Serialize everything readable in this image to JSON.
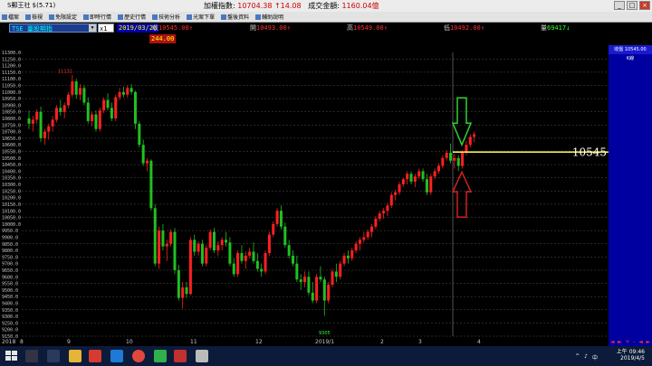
{
  "window": {
    "title": "S郵王社 $(5.71)",
    "min_label": "_",
    "max_label": "□",
    "close_label": "×"
  },
  "index_info": {
    "label": "加權指數:",
    "value": "10704.38",
    "change": "↑14.08",
    "volume_label": "成交金額:",
    "volume": "1160.04億"
  },
  "menu": [
    {
      "label": "檔案"
    },
    {
      "label": "檢視"
    },
    {
      "label": "免限設定"
    },
    {
      "label": "即時行情"
    },
    {
      "label": "歷史行情"
    },
    {
      "label": "技術分析"
    },
    {
      "label": "光案下單"
    },
    {
      "label": "盤後資料"
    },
    {
      "label": "輔助說明"
    }
  ],
  "toolbar": {
    "stock": "TSE 臺股期指",
    "stock_dropdown": "▼",
    "multiplier": "x1",
    "date": "2019/03/20",
    "quotes": [
      {
        "label": "收",
        "value": "10545.00↑",
        "color": "red"
      },
      {
        "label": "開",
        "value": "10493.00↑",
        "color": "red"
      },
      {
        "label": "高",
        "value": "10549.00↑",
        "color": "red"
      },
      {
        "label": "低",
        "value": "10492.00↑",
        "color": "red"
      },
      {
        "label": "量",
        "value": "69417↓",
        "color": "green"
      }
    ],
    "sub_price": "244.00"
  },
  "chart_data": {
    "type": "candlestick",
    "y_ticks": [
      "11300.0",
      "11250.0",
      "11200.0",
      "11150.0",
      "11100.0",
      "11050.0",
      "11000.0",
      "10950.0",
      "10900.0",
      "10850.0",
      "10800.0",
      "10750.0",
      "10700.0",
      "10650.0",
      "10600.0",
      "10550.0",
      "10500.0",
      "10450.0",
      "10400.0",
      "10350.0",
      "10300.0",
      "10250.0",
      "10200.0",
      "10150.0",
      "10100.0",
      "10050.0",
      "10000.0",
      "9950.0",
      "9900.0",
      "9850.0",
      "9800.0",
      "9750.0",
      "9700.0",
      "9650.0",
      "9600.0",
      "9550.0",
      "9500.0",
      "9450.0",
      "9400.0",
      "9350.0",
      "9300.0",
      "9250.0",
      "9200.0",
      "9150.0"
    ],
    "ylim": [
      9150,
      11300
    ],
    "x_ticks": [
      "2018",
      "8",
      "9",
      "10",
      "11",
      "12",
      "2019/1",
      "2",
      "3",
      "4"
    ],
    "high_annotation": "11131",
    "low_annotation": "9305",
    "current_price_line": 10545,
    "current_price_label": "10545",
    "cursor_label": "10545.00",
    "cursor_title": "收盤",
    "cursor_panel_label": "K線",
    "grid": true,
    "candles": [
      {
        "o": 10800,
        "h": 10860,
        "l": 10720,
        "c": 10760
      },
      {
        "o": 10760,
        "h": 10820,
        "l": 10700,
        "c": 10790
      },
      {
        "o": 10790,
        "h": 10870,
        "l": 10760,
        "c": 10850
      },
      {
        "o": 10850,
        "h": 10890,
        "l": 10620,
        "c": 10650
      },
      {
        "o": 10650,
        "h": 10720,
        "l": 10600,
        "c": 10700
      },
      {
        "o": 10700,
        "h": 10760,
        "l": 10640,
        "c": 10740
      },
      {
        "o": 10740,
        "h": 10820,
        "l": 10700,
        "c": 10790
      },
      {
        "o": 10790,
        "h": 10900,
        "l": 10770,
        "c": 10880
      },
      {
        "o": 10880,
        "h": 10940,
        "l": 10820,
        "c": 10850
      },
      {
        "o": 10850,
        "h": 10920,
        "l": 10800,
        "c": 10900
      },
      {
        "o": 10900,
        "h": 11000,
        "l": 10880,
        "c": 10980
      },
      {
        "o": 10980,
        "h": 11131,
        "l": 10960,
        "c": 11080
      },
      {
        "o": 11080,
        "h": 11100,
        "l": 10950,
        "c": 10980
      },
      {
        "o": 10980,
        "h": 11060,
        "l": 10940,
        "c": 11030
      },
      {
        "o": 11030,
        "h": 11050,
        "l": 10900,
        "c": 10920
      },
      {
        "o": 10920,
        "h": 10960,
        "l": 10760,
        "c": 10780
      },
      {
        "o": 10780,
        "h": 10850,
        "l": 10740,
        "c": 10830
      },
      {
        "o": 10830,
        "h": 10860,
        "l": 10700,
        "c": 10720
      },
      {
        "o": 10720,
        "h": 10880,
        "l": 10700,
        "c": 10860
      },
      {
        "o": 10860,
        "h": 10960,
        "l": 10840,
        "c": 10940
      },
      {
        "o": 10940,
        "h": 10990,
        "l": 10860,
        "c": 10880
      },
      {
        "o": 10880,
        "h": 10920,
        "l": 10780,
        "c": 10800
      },
      {
        "o": 10800,
        "h": 10980,
        "l": 10780,
        "c": 10960
      },
      {
        "o": 10960,
        "h": 11030,
        "l": 10940,
        "c": 11000
      },
      {
        "o": 11000,
        "h": 11040,
        "l": 10960,
        "c": 10980
      },
      {
        "o": 10980,
        "h": 11050,
        "l": 10960,
        "c": 11030
      },
      {
        "o": 11030,
        "h": 11060,
        "l": 10980,
        "c": 11000
      },
      {
        "o": 11000,
        "h": 11010,
        "l": 10720,
        "c": 10760
      },
      {
        "o": 10760,
        "h": 10780,
        "l": 10580,
        "c": 10600
      },
      {
        "o": 10600,
        "h": 10640,
        "l": 10440,
        "c": 10460
      },
      {
        "o": 10460,
        "h": 10500,
        "l": 10400,
        "c": 10480
      },
      {
        "o": 10480,
        "h": 10490,
        "l": 10100,
        "c": 10120
      },
      {
        "o": 10120,
        "h": 10150,
        "l": 9680,
        "c": 9700
      },
      {
        "o": 9700,
        "h": 9980,
        "l": 9660,
        "c": 9950
      },
      {
        "o": 9950,
        "h": 10000,
        "l": 9800,
        "c": 9830
      },
      {
        "o": 9830,
        "h": 9880,
        "l": 9720,
        "c": 9850
      },
      {
        "o": 9850,
        "h": 9960,
        "l": 9830,
        "c": 9940
      },
      {
        "o": 9940,
        "h": 9970,
        "l": 9620,
        "c": 9650
      },
      {
        "o": 9650,
        "h": 9690,
        "l": 9420,
        "c": 9440
      },
      {
        "o": 9440,
        "h": 9560,
        "l": 9360,
        "c": 9520
      },
      {
        "o": 9520,
        "h": 9560,
        "l": 9440,
        "c": 9470
      },
      {
        "o": 9470,
        "h": 9900,
        "l": 9460,
        "c": 9880
      },
      {
        "o": 9880,
        "h": 9920,
        "l": 9760,
        "c": 9790
      },
      {
        "o": 9790,
        "h": 9870,
        "l": 9760,
        "c": 9850
      },
      {
        "o": 9850,
        "h": 9880,
        "l": 9680,
        "c": 9700
      },
      {
        "o": 9700,
        "h": 9840,
        "l": 9680,
        "c": 9820
      },
      {
        "o": 9820,
        "h": 9960,
        "l": 9800,
        "c": 9940
      },
      {
        "o": 9940,
        "h": 9970,
        "l": 9780,
        "c": 9800
      },
      {
        "o": 9800,
        "h": 9870,
        "l": 9760,
        "c": 9840
      },
      {
        "o": 9840,
        "h": 9900,
        "l": 9800,
        "c": 9880
      },
      {
        "o": 9880,
        "h": 9940,
        "l": 9830,
        "c": 9860
      },
      {
        "o": 9860,
        "h": 9900,
        "l": 9680,
        "c": 9700
      },
      {
        "o": 9700,
        "h": 9740,
        "l": 9600,
        "c": 9620
      },
      {
        "o": 9620,
        "h": 9800,
        "l": 9600,
        "c": 9780
      },
      {
        "o": 9780,
        "h": 9840,
        "l": 9700,
        "c": 9720
      },
      {
        "o": 9720,
        "h": 9790,
        "l": 9660,
        "c": 9760
      },
      {
        "o": 9760,
        "h": 9820,
        "l": 9740,
        "c": 9790
      },
      {
        "o": 9790,
        "h": 9860,
        "l": 9700,
        "c": 9720
      },
      {
        "o": 9720,
        "h": 9780,
        "l": 9640,
        "c": 9660
      },
      {
        "o": 9660,
        "h": 9700,
        "l": 9600,
        "c": 9640
      },
      {
        "o": 9640,
        "h": 9800,
        "l": 9620,
        "c": 9780
      },
      {
        "o": 9780,
        "h": 9940,
        "l": 9760,
        "c": 9920
      },
      {
        "o": 9920,
        "h": 10020,
        "l": 9900,
        "c": 10000
      },
      {
        "o": 10000,
        "h": 10120,
        "l": 9980,
        "c": 10100
      },
      {
        "o": 10100,
        "h": 10140,
        "l": 9960,
        "c": 9980
      },
      {
        "o": 9980,
        "h": 10010,
        "l": 9820,
        "c": 9840
      },
      {
        "o": 9840,
        "h": 9880,
        "l": 9740,
        "c": 9760
      },
      {
        "o": 9760,
        "h": 9800,
        "l": 9680,
        "c": 9700
      },
      {
        "o": 9700,
        "h": 9760,
        "l": 9560,
        "c": 9580
      },
      {
        "o": 9580,
        "h": 9620,
        "l": 9500,
        "c": 9560
      },
      {
        "o": 9560,
        "h": 9640,
        "l": 9520,
        "c": 9600
      },
      {
        "o": 9600,
        "h": 9640,
        "l": 9460,
        "c": 9480
      },
      {
        "o": 9480,
        "h": 9560,
        "l": 9400,
        "c": 9420
      },
      {
        "o": 9420,
        "h": 9620,
        "l": 9400,
        "c": 9600
      },
      {
        "o": 9600,
        "h": 9680,
        "l": 9560,
        "c": 9580
      },
      {
        "o": 9580,
        "h": 9600,
        "l": 9305,
        "c": 9420
      },
      {
        "o": 9420,
        "h": 9560,
        "l": 9400,
        "c": 9540
      },
      {
        "o": 9540,
        "h": 9660,
        "l": 9520,
        "c": 9640
      },
      {
        "o": 9640,
        "h": 9700,
        "l": 9560,
        "c": 9600
      },
      {
        "o": 9600,
        "h": 9720,
        "l": 9580,
        "c": 9700
      },
      {
        "o": 9700,
        "h": 9780,
        "l": 9680,
        "c": 9760
      },
      {
        "o": 9760,
        "h": 9800,
        "l": 9700,
        "c": 9740
      },
      {
        "o": 9740,
        "h": 9820,
        "l": 9720,
        "c": 9800
      },
      {
        "o": 9800,
        "h": 9870,
        "l": 9780,
        "c": 9850
      },
      {
        "o": 9850,
        "h": 9900,
        "l": 9800,
        "c": 9880
      },
      {
        "o": 9880,
        "h": 9940,
        "l": 9860,
        "c": 9900
      },
      {
        "o": 9900,
        "h": 9960,
        "l": 9880,
        "c": 9940
      },
      {
        "o": 9940,
        "h": 10000,
        "l": 9900,
        "c": 9980
      },
      {
        "o": 9980,
        "h": 10060,
        "l": 9960,
        "c": 10040
      },
      {
        "o": 10040,
        "h": 10100,
        "l": 10020,
        "c": 10080
      },
      {
        "o": 10080,
        "h": 10120,
        "l": 10040,
        "c": 10100
      },
      {
        "o": 10100,
        "h": 10160,
        "l": 10060,
        "c": 10140
      },
      {
        "o": 10140,
        "h": 10240,
        "l": 10120,
        "c": 10220
      },
      {
        "o": 10220,
        "h": 10260,
        "l": 10180,
        "c": 10240
      },
      {
        "o": 10240,
        "h": 10320,
        "l": 10220,
        "c": 10300
      },
      {
        "o": 10300,
        "h": 10350,
        "l": 10280,
        "c": 10340
      },
      {
        "o": 10340,
        "h": 10400,
        "l": 10300,
        "c": 10380
      },
      {
        "o": 10380,
        "h": 10400,
        "l": 10300,
        "c": 10320
      },
      {
        "o": 10320,
        "h": 10380,
        "l": 10280,
        "c": 10360
      },
      {
        "o": 10360,
        "h": 10420,
        "l": 10340,
        "c": 10400
      },
      {
        "o": 10400,
        "h": 10420,
        "l": 10320,
        "c": 10340
      },
      {
        "o": 10340,
        "h": 10380,
        "l": 10220,
        "c": 10240
      },
      {
        "o": 10240,
        "h": 10380,
        "l": 10220,
        "c": 10360
      },
      {
        "o": 10360,
        "h": 10420,
        "l": 10340,
        "c": 10400
      },
      {
        "o": 10400,
        "h": 10460,
        "l": 10380,
        "c": 10440
      },
      {
        "o": 10440,
        "h": 10520,
        "l": 10420,
        "c": 10500
      },
      {
        "o": 10500,
        "h": 10560,
        "l": 10480,
        "c": 10540
      },
      {
        "o": 10540,
        "h": 10610,
        "l": 10460,
        "c": 10480
      },
      {
        "o": 10480,
        "h": 10530,
        "l": 10420,
        "c": 10500
      },
      {
        "o": 10500,
        "h": 10520,
        "l": 10400,
        "c": 10440
      },
      {
        "o": 10440,
        "h": 10560,
        "l": 10420,
        "c": 10540
      },
      {
        "o": 10540,
        "h": 10630,
        "l": 10520,
        "c": 10600
      },
      {
        "o": 10600,
        "h": 10680,
        "l": 10580,
        "c": 10660
      },
      {
        "o": 10660,
        "h": 10700,
        "l": 10620,
        "c": 10680
      }
    ]
  },
  "right_panel": {
    "price_label": "10545"
  },
  "nav": [
    "◄",
    "►",
    "+",
    "-",
    "◄",
    "►"
  ],
  "taskbar": {
    "time": "上午 09:46",
    "date": "2019/4/5",
    "tray": [
      "^",
      "♪",
      "中"
    ]
  },
  "colors": {
    "up": "#ff2020",
    "down": "#20c020",
    "price_line": "#ffff60",
    "arrow_down": "#30d030",
    "arrow_up": "#d02020",
    "grid": "#505050"
  }
}
